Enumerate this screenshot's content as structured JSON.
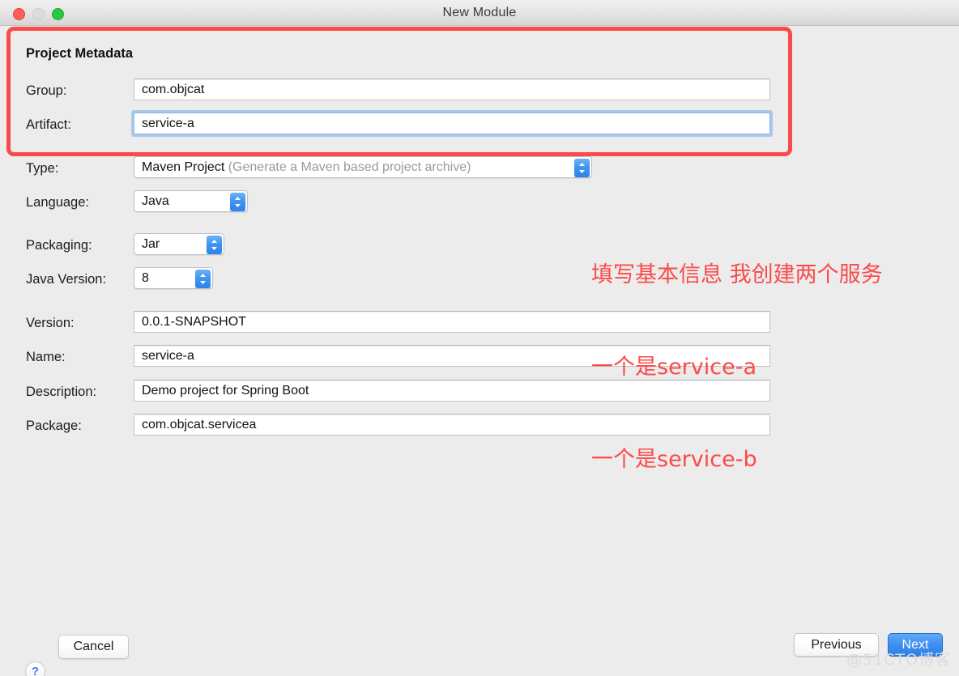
{
  "window": {
    "title": "New Module",
    "traffic_lights": [
      "close-button",
      "minimize-button",
      "zoom-button"
    ]
  },
  "form": {
    "section_title": "Project Metadata",
    "group": {
      "label": "Group:",
      "value": "com.objcat"
    },
    "artifact": {
      "label": "Artifact:",
      "value": "service-a"
    },
    "type": {
      "label": "Type:",
      "value": "Maven Project",
      "hint": "(Generate a Maven based project archive)"
    },
    "language": {
      "label": "Language:",
      "value": "Java"
    },
    "packaging": {
      "label": "Packaging:",
      "value": "Jar"
    },
    "java_version": {
      "label": "Java Version:",
      "value": "8"
    },
    "version": {
      "label": "Version:",
      "value": "0.0.1-SNAPSHOT"
    },
    "name": {
      "label": "Name:",
      "value": "service-a"
    },
    "description": {
      "label": "Description:",
      "value": "Demo project for Spring Boot"
    },
    "package": {
      "label": "Package:",
      "value": "com.objcat.servicea"
    }
  },
  "annotation": {
    "line1": "填写基本信息 我创建两个服务",
    "line2": "一个是service-a",
    "line3": "一个是service-b",
    "color": "#fb4a4a"
  },
  "highlight_box": {
    "color": "#fb4a4a"
  },
  "footer": {
    "help_label": "?",
    "cancel_label": "Cancel",
    "previous_label": "Previous",
    "next_label": "Next",
    "next_color": "#2b7fe9"
  },
  "watermark": {
    "text": "@51CTO博客"
  }
}
